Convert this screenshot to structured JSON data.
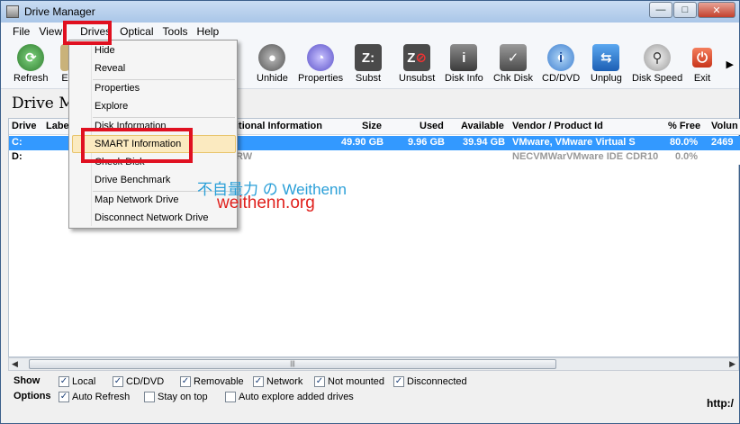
{
  "window": {
    "title": "Drive Manager"
  },
  "menubar": [
    "File",
    "View",
    "Drives",
    "Optical",
    "Tools",
    "Help"
  ],
  "toolbar": {
    "left": [
      {
        "label": "Refresh",
        "icon": "refresh-icon"
      },
      {
        "label": "E",
        "icon": "explore-icon"
      }
    ],
    "right": [
      {
        "label": "Unhide",
        "icon": "unhide-icon"
      },
      {
        "label": "Properties",
        "icon": "properties-icon"
      },
      {
        "label": "Subst",
        "icon": "subst-icon"
      },
      {
        "label": "Unsubst",
        "icon": "unsubst-icon"
      },
      {
        "label": "Disk Info",
        "icon": "disk-info-icon"
      },
      {
        "label": "Chk Disk",
        "icon": "chk-disk-icon"
      },
      {
        "label": "CD/DVD",
        "icon": "cd-dvd-icon"
      },
      {
        "label": "Unplug",
        "icon": "unplug-icon"
      },
      {
        "label": "Disk Speed",
        "icon": "disk-speed-icon"
      },
      {
        "label": "Exit",
        "icon": "exit-icon"
      }
    ]
  },
  "heading": "Drive M",
  "table": {
    "headers": [
      "Drive",
      "Labe",
      "itional Information",
      "Size",
      "Used",
      "Available",
      "Vendor / Product Id",
      "% Free",
      "Volun"
    ],
    "rows": [
      {
        "drive": "C:",
        "info": "",
        "size": "49.90 GB",
        "used": "9.96 GB",
        "available": "39.94 GB",
        "vendor": "VMware, VMware Virtual S",
        "free": "80.0%",
        "vol": "2469"
      },
      {
        "drive": "D:",
        "info": "RW",
        "size": "",
        "used": "",
        "available": "",
        "vendor": "NECVMWarVMware IDE CDR10",
        "free": "0.0%",
        "vol": ""
      }
    ]
  },
  "dropdown": {
    "items": [
      "Hide",
      "Reveal",
      "Properties",
      "Explore",
      "Disk Information",
      "SMART Information",
      "Check Disk",
      "Drive Benchmark",
      "Map Network Drive",
      "Disconnect Network Drive"
    ],
    "highlighted": "SMART Information"
  },
  "show": {
    "label": "Show",
    "items": [
      {
        "label": "Local",
        "checked": true
      },
      {
        "label": "CD/DVD",
        "checked": true
      },
      {
        "label": "Removable",
        "checked": true
      },
      {
        "label": "Network",
        "checked": true
      },
      {
        "label": "Not mounted",
        "checked": true
      },
      {
        "label": "Disconnected",
        "checked": true
      }
    ]
  },
  "options": {
    "label": "Options",
    "items": [
      {
        "label": "Auto Refresh",
        "checked": true
      },
      {
        "label": "Stay on top",
        "checked": false
      },
      {
        "label": "Auto explore added drives",
        "checked": false
      }
    ]
  },
  "footer_text": "http:/",
  "watermark": {
    "line1": "不自量力 の Weithenn",
    "line2": "weithenn.org"
  },
  "colors": {
    "selection": "#3399ff",
    "highlight_box": "#e01020",
    "hover": "#fbeac0"
  }
}
